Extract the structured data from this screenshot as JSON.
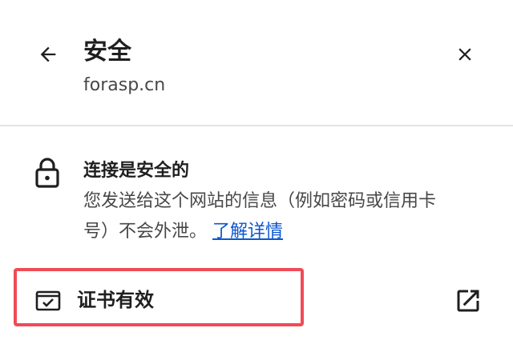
{
  "header": {
    "title": "安全",
    "site": "forasp.cn",
    "back_icon": "arrow-left-icon",
    "close_icon": "close-icon"
  },
  "connection": {
    "icon": "lock-icon",
    "title": "连接是安全的",
    "description_line1": "您发送给这个网站的信息（例如密码或信用卡",
    "description_line2": "号）不会外泄。",
    "learn_more": "了解详情"
  },
  "certificate": {
    "icon": "certificate-icon",
    "label": "证书有效",
    "external_icon": "open-in-new-icon"
  },
  "colors": {
    "link": "#0b57d0",
    "highlight": "#f04b55",
    "divider": "#dfe3e8"
  }
}
